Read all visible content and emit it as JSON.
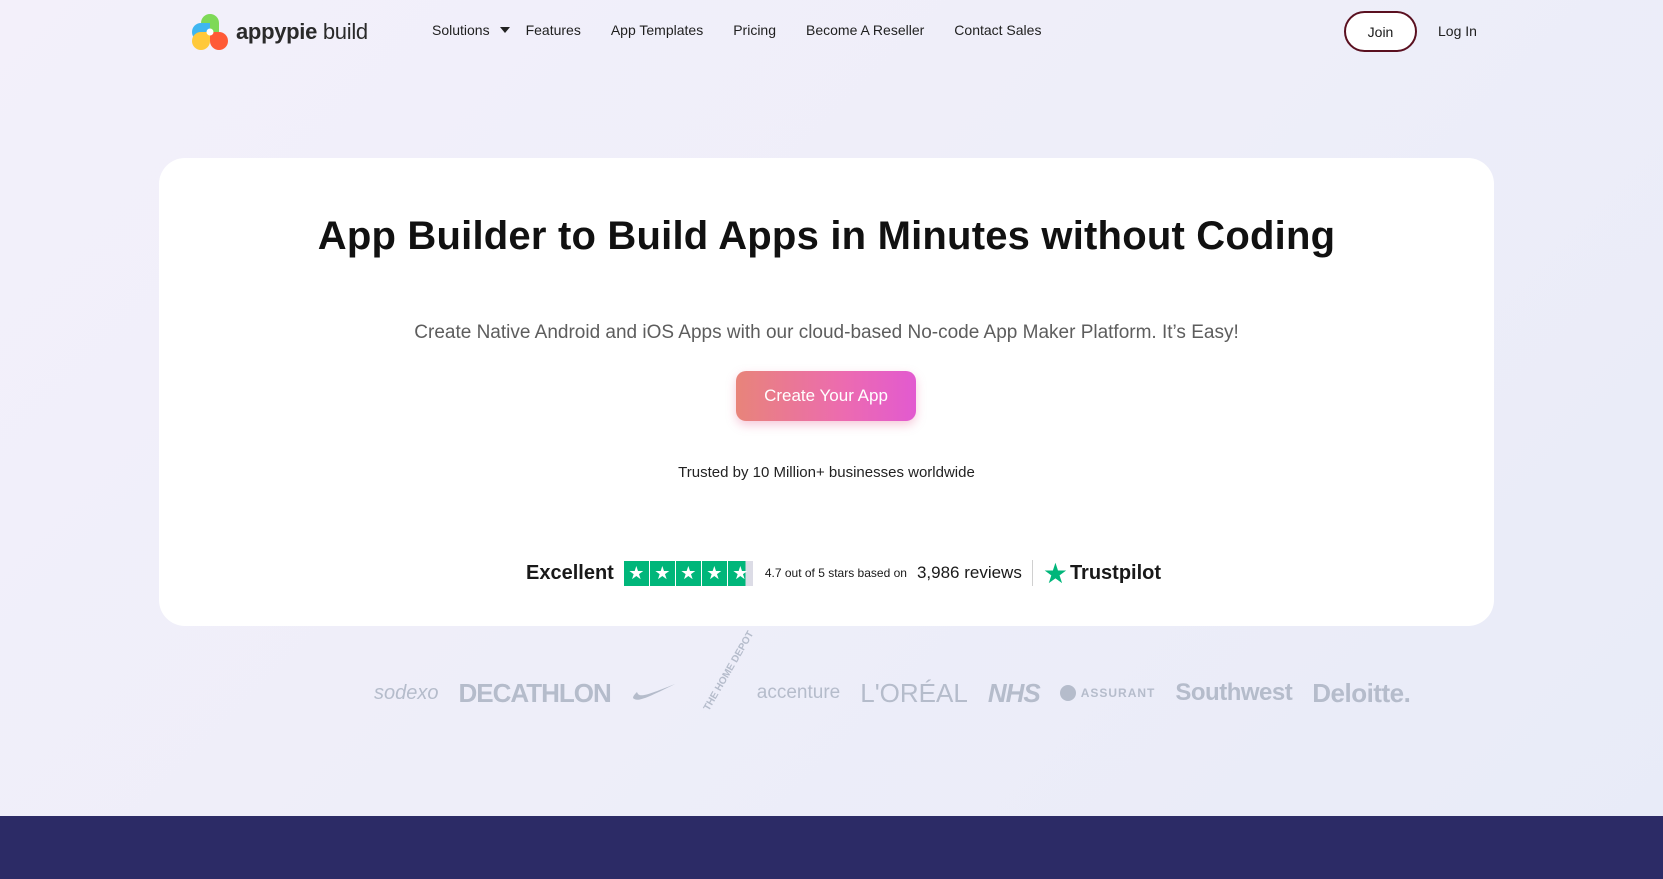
{
  "header": {
    "logo": {
      "brand_bold": "appypie",
      "brand_rest": " build"
    },
    "nav": [
      {
        "label": "Solutions",
        "has_dropdown": true
      },
      {
        "label": "Features"
      },
      {
        "label": "App Templates"
      },
      {
        "label": "Pricing"
      },
      {
        "label": "Become A Reseller"
      },
      {
        "label": "Contact Sales"
      }
    ],
    "join_label": "Join",
    "login_label": "Log In"
  },
  "hero": {
    "title": "App Builder to Build Apps in Minutes without Coding",
    "subtitle": "Create Native Android and iOS Apps with our cloud-based No-code App Maker Platform. It’s Easy!",
    "cta_label": "Create Your App",
    "trusted": "Trusted by 10 Million+ businesses worldwide"
  },
  "trustpilot": {
    "rating_word": "Excellent",
    "stars": 4.7,
    "score_text": "4.7 out of 5 stars based on",
    "reviews_text": "3,986 reviews",
    "brand": "Trustpilot",
    "brand_color": "#00b67a"
  },
  "client_logos": [
    {
      "name": "sodexo"
    },
    {
      "name": "DECATHLON"
    },
    {
      "name": "nike-swoosh"
    },
    {
      "name": "THE HOME DEPOT"
    },
    {
      "name": "accenture"
    },
    {
      "name": "L'ORÉAL"
    },
    {
      "name": "NHS"
    },
    {
      "name": "ASSURANT"
    },
    {
      "name": "Southwest"
    },
    {
      "name": "Deloitte."
    }
  ],
  "colors": {
    "cta_gradient_start": "#e8847a",
    "cta_gradient_end": "#e25ad0",
    "footer_band": "#2c2b66",
    "join_border": "#5a1020"
  }
}
